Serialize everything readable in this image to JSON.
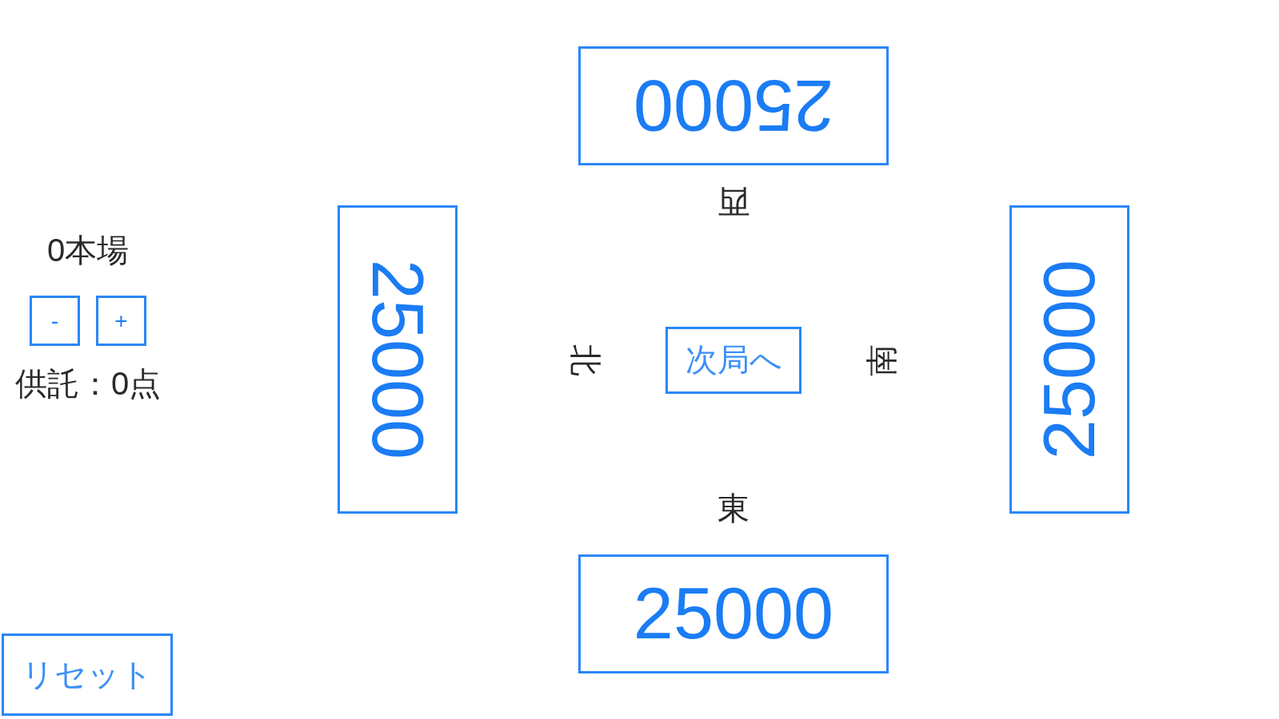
{
  "sidebar": {
    "honba": "0本場",
    "stepper_buttons": [
      {
        "label": "-"
      },
      {
        "label": "+"
      }
    ],
    "deposit": "供託：0点",
    "reset_button": "リセット"
  },
  "table": {
    "seats": [
      {
        "kind": "top",
        "score": "25000",
        "wind": "西"
      },
      {
        "kind": "left",
        "score": "25000",
        "wind": "北"
      },
      {
        "kind": "right",
        "score": "25000",
        "wind": "南"
      },
      {
        "kind": "bottom",
        "score": "25000",
        "wind": "東"
      }
    ],
    "next_round_button": "次局へ"
  }
}
